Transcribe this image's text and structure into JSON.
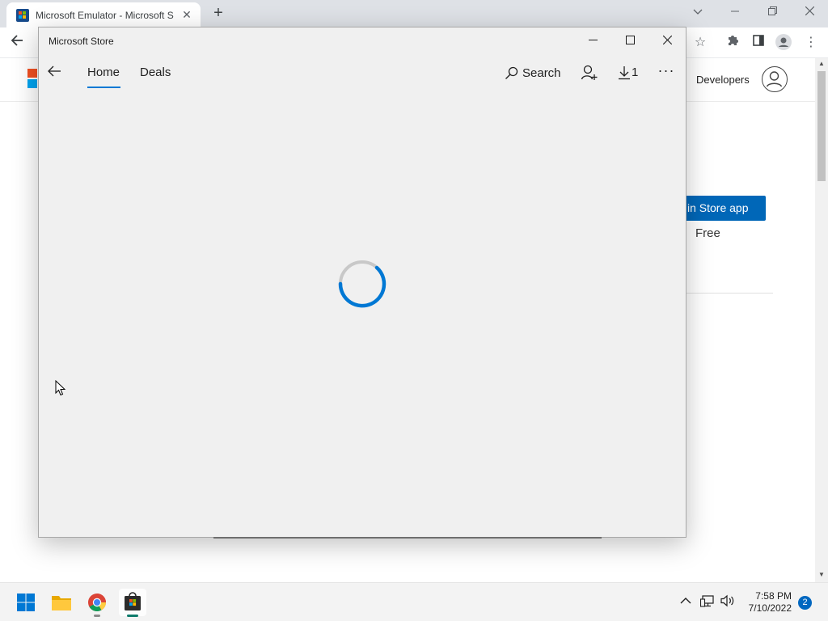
{
  "browser": {
    "tab_title": "Microsoft Emulator - Microsoft S",
    "tab_close": "✕",
    "new_tab": "+"
  },
  "page": {
    "developers_link": "Developers",
    "store_button": "in Store app",
    "price": "Free"
  },
  "store_window": {
    "title": "Microsoft Store",
    "nav": {
      "home": "Home",
      "deals": "Deals",
      "search": "Search",
      "downloads_count": "1",
      "more": "···"
    },
    "loading": true,
    "accent_color": "#0078d4"
  },
  "taskbar": {
    "time": "7:58 PM",
    "date": "7/10/2022",
    "notification_count": "2",
    "apps": [
      "start-icon",
      "file-explorer-icon",
      "chrome-icon",
      "microsoft-store-icon"
    ]
  }
}
